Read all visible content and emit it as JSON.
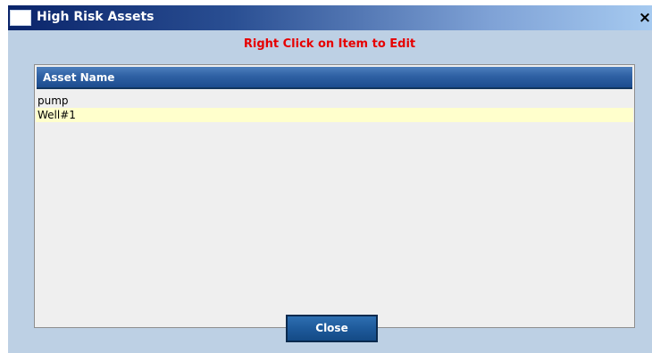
{
  "window": {
    "title": "High Risk Assets",
    "close_glyph": "×"
  },
  "instruction": "Right Click on Item to Edit",
  "list": {
    "column_header": "Asset Name",
    "items": [
      {
        "label": "pump",
        "selected": false
      },
      {
        "label": "Well#1",
        "selected": true
      }
    ]
  },
  "buttons": {
    "close_label": "Close"
  },
  "colors": {
    "instruction_text": "#e60000",
    "dialog_background": "#bdd0e4",
    "selected_row": "#ffffcc",
    "header_blue": "#2f61a4"
  },
  "icons": {
    "title_icon": "window-icon",
    "close_icon": "close-icon"
  }
}
